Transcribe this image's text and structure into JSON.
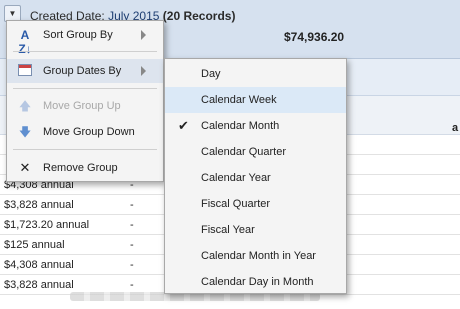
{
  "group": {
    "toggle": "▼",
    "label": "Created Date:",
    "value": "July 2015",
    "count": "(20 Records)",
    "total": "$74,936.20"
  },
  "column_hint": "a",
  "rows": [
    {
      "amount": "$4,308 annual",
      "dash": "-"
    },
    {
      "amount": "$3,828 annual",
      "dash": "-"
    },
    {
      "amount": "$1,723.20 annual",
      "dash": "-"
    },
    {
      "amount": "$125 annual",
      "dash": "-"
    },
    {
      "amount": "$4,308 annual",
      "dash": "-"
    },
    {
      "amount": "$3,828 annual",
      "dash": "-"
    }
  ],
  "menu": {
    "sort_group_by": "Sort Group By",
    "group_dates_by": "Group Dates By",
    "move_group_up": "Move Group Up",
    "move_group_down": "Move Group Down",
    "remove_group": "Remove Group"
  },
  "submenu": {
    "items": [
      {
        "label": "Day",
        "checked": false
      },
      {
        "label": "Calendar Week",
        "checked": false,
        "hover": true
      },
      {
        "label": "Calendar Month",
        "checked": true
      },
      {
        "label": "Calendar Quarter",
        "checked": false
      },
      {
        "label": "Calendar Year",
        "checked": false
      },
      {
        "label": "Fiscal Quarter",
        "checked": false
      },
      {
        "label": "Fiscal Year",
        "checked": false
      },
      {
        "label": "Calendar Month in Year",
        "checked": false
      },
      {
        "label": "Calendar Day in Month",
        "checked": false
      }
    ],
    "check_glyph": "✔"
  },
  "colors": {
    "header_bg": "#d6e1ef",
    "menu_bg": "#f4f4f4",
    "hover_bg": "#dbe9f7",
    "link_blue": "#1f3f73"
  }
}
